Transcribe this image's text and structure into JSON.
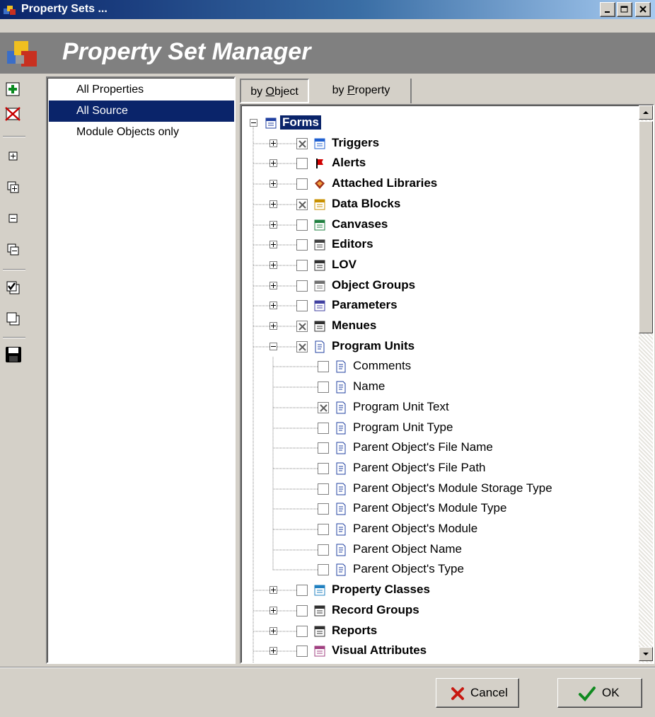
{
  "window": {
    "title": "Property Sets ...",
    "buttons": [
      "minimize",
      "maximize",
      "close"
    ]
  },
  "banner": {
    "title": "Property Set Manager"
  },
  "toolbar": {
    "icons": [
      "add-set-icon",
      "delete-set-icon",
      "expand-icon",
      "expand-all-icon",
      "collapse-icon",
      "collapse-all-icon",
      "check-all-icon",
      "uncheck-all-icon",
      "save-icon"
    ]
  },
  "property_sets": [
    {
      "label": "All Properties",
      "selected": false
    },
    {
      "label": "All Source",
      "selected": true
    },
    {
      "label": "Module Objects only",
      "selected": false
    }
  ],
  "tabs": [
    {
      "prefix": "by ",
      "mnemonic": "O",
      "rest": "bject",
      "active": true
    },
    {
      "prefix": "by ",
      "mnemonic": "P",
      "rest": "roperty",
      "active": false
    }
  ],
  "tree": {
    "root": "Forms",
    "nodes": [
      {
        "label": "Triggers",
        "checked": true,
        "icon": "trigger-icon",
        "expanded": false
      },
      {
        "label": "Alerts",
        "checked": false,
        "icon": "alert-flag-icon",
        "expanded": false
      },
      {
        "label": "Attached Libraries",
        "checked": false,
        "icon": "library-icon",
        "expanded": false
      },
      {
        "label": "Data Blocks",
        "checked": true,
        "icon": "data-block-icon",
        "expanded": false
      },
      {
        "label": "Canvases",
        "checked": false,
        "icon": "canvas-icon",
        "expanded": false
      },
      {
        "label": "Editors",
        "checked": false,
        "icon": "editor-icon",
        "expanded": false
      },
      {
        "label": "LOV",
        "checked": false,
        "icon": "lov-icon",
        "expanded": false
      },
      {
        "label": "Object Groups",
        "checked": false,
        "icon": "object-group-icon",
        "expanded": false
      },
      {
        "label": "Parameters",
        "checked": false,
        "icon": "parameter-icon",
        "expanded": false
      },
      {
        "label": "Menues",
        "checked": true,
        "icon": "menu-icon",
        "expanded": false
      },
      {
        "label": "Program Units",
        "checked": true,
        "icon": "program-unit-icon",
        "expanded": true,
        "children": [
          {
            "label": "Comments",
            "checked": false
          },
          {
            "label": "Name",
            "checked": false
          },
          {
            "label": "Program Unit Text",
            "checked": true
          },
          {
            "label": "Program Unit Type",
            "checked": false
          },
          {
            "label": "Parent Object's File Name",
            "checked": false
          },
          {
            "label": "Parent Object's File Path",
            "checked": false
          },
          {
            "label": "Parent Object's Module Storage Type",
            "checked": false
          },
          {
            "label": "Parent Object's Module Type",
            "checked": false
          },
          {
            "label": "Parent Object's Module",
            "checked": false
          },
          {
            "label": "Parent Object Name",
            "checked": false
          },
          {
            "label": "Parent Object's Type",
            "checked": false
          }
        ]
      },
      {
        "label": "Property Classes",
        "checked": false,
        "icon": "property-class-icon",
        "expanded": false
      },
      {
        "label": "Record Groups",
        "checked": false,
        "icon": "record-group-icon",
        "expanded": false
      },
      {
        "label": "Reports",
        "checked": false,
        "icon": "report-icon",
        "expanded": false
      },
      {
        "label": "Visual Attributes",
        "checked": false,
        "icon": "visual-attribute-icon",
        "expanded": false
      }
    ]
  },
  "buttons": {
    "cancel": "Cancel",
    "ok": "OK"
  }
}
